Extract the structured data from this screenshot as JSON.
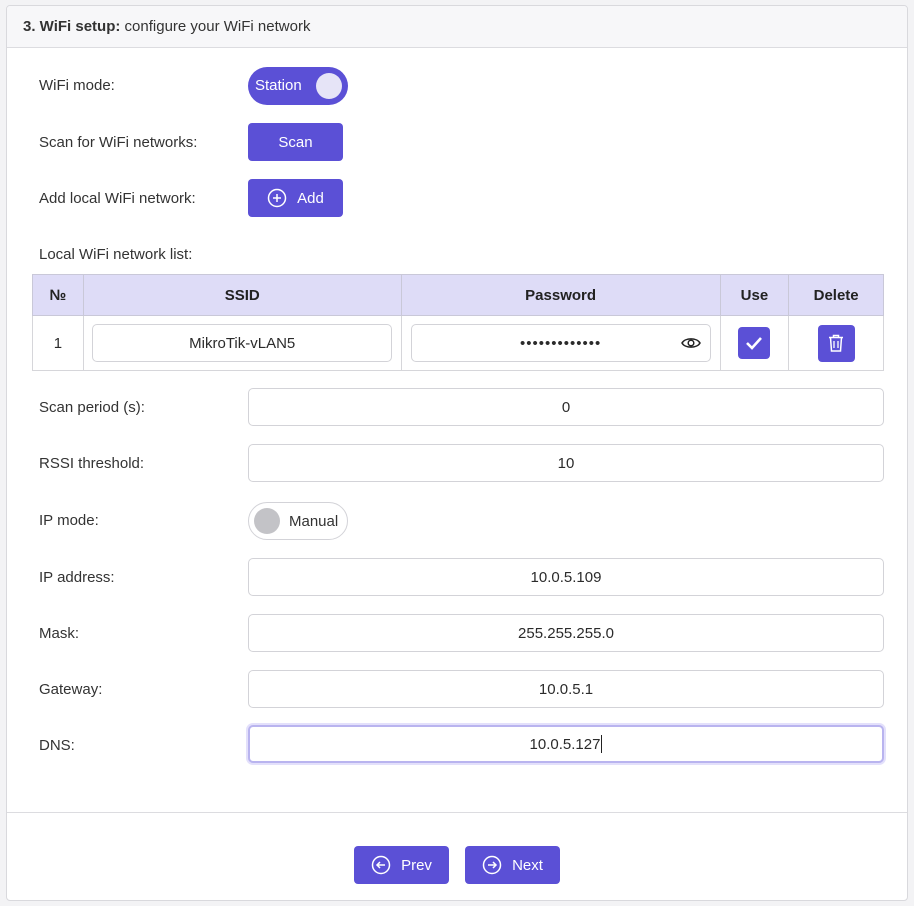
{
  "header": {
    "step": "3. WiFi setup:",
    "subtitle": "configure your WiFi network"
  },
  "wifi_mode": {
    "label": "WiFi mode:",
    "toggle_text": "Station",
    "on": true
  },
  "scan": {
    "label": "Scan for WiFi networks:",
    "button": "Scan"
  },
  "add": {
    "label": "Add local WiFi network:",
    "button": "Add"
  },
  "list": {
    "label": "Local WiFi network list:",
    "columns": [
      "№",
      "SSID",
      "Password",
      "Use",
      "Delete"
    ],
    "rows": [
      {
        "num": "1",
        "ssid": "MikroTik-vLAN5",
        "password": "•••••••••••••",
        "use": true
      }
    ]
  },
  "scan_period": {
    "label": "Scan period (s):",
    "value": "0"
  },
  "rssi": {
    "label": "RSSI threshold:",
    "value": "10"
  },
  "ip_mode": {
    "label": "IP mode:",
    "toggle_text": "Manual",
    "on": false
  },
  "ip_address": {
    "label": "IP address:",
    "value": "10.0.5.109"
  },
  "mask": {
    "label": "Mask:",
    "value": "255.255.255.0"
  },
  "gateway": {
    "label": "Gateway:",
    "value": "10.0.5.1"
  },
  "dns": {
    "label": "DNS:",
    "value": "10.0.5.127"
  },
  "footer": {
    "prev": "Prev",
    "next": "Next"
  },
  "colors": {
    "accent": "#5b50d6",
    "table_header": "#dedcf7"
  }
}
